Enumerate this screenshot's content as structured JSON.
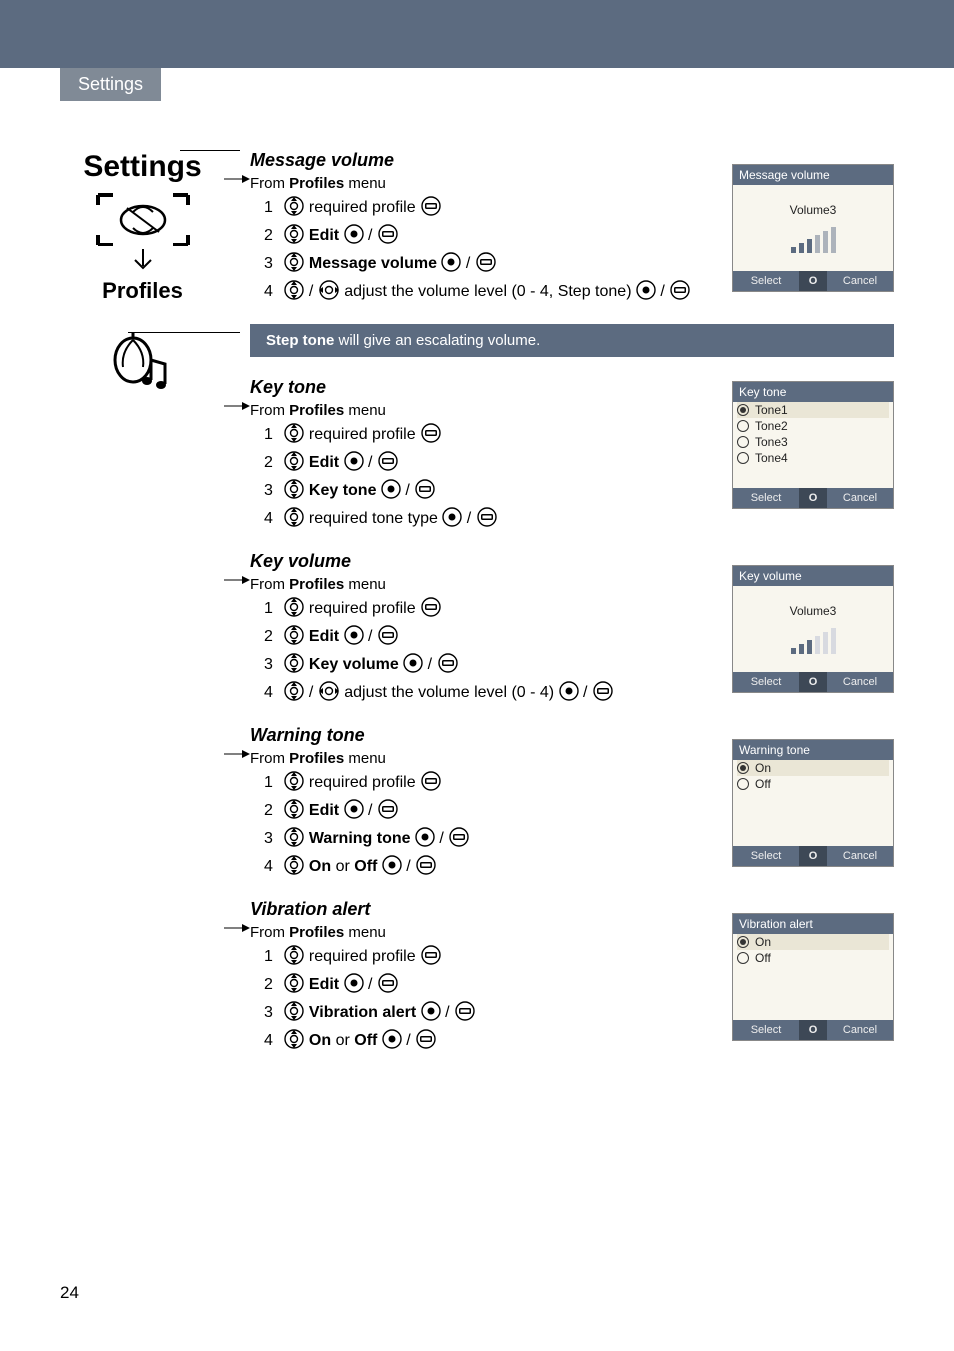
{
  "header": {
    "section": "Settings"
  },
  "sidebar": {
    "title": "Settings",
    "subtitle": "Profiles"
  },
  "sections": {
    "msg_volume": {
      "title": "Message volume",
      "from": "From",
      "from_bold": "Profiles",
      "from_tail": "menu",
      "steps": [
        {
          "n": "1",
          "text": "required profile"
        },
        {
          "n": "2",
          "bold": "Edit"
        },
        {
          "n": "3",
          "bold": "Message volume"
        },
        {
          "n": "4",
          "text": "adjust the volume level (0 - 4, Step tone)"
        }
      ],
      "screen": {
        "title": "Message volume",
        "body": "Volume3",
        "sk_l": "Select",
        "sk_c": "O",
        "sk_r": "Cancel"
      }
    },
    "note": {
      "bold": "Step tone",
      "text": " will give an escalating volume."
    },
    "key_tone": {
      "title": "Key tone",
      "from": "From",
      "from_bold": "Profiles",
      "from_tail": "menu",
      "steps": [
        {
          "n": "1",
          "text": "required profile"
        },
        {
          "n": "2",
          "bold": "Edit"
        },
        {
          "n": "3",
          "bold": "Key tone"
        },
        {
          "n": "4",
          "text": "required tone type"
        }
      ],
      "screen": {
        "title": "Key tone",
        "opts": [
          "Tone1",
          "Tone2",
          "Tone3",
          "Tone4"
        ],
        "sk_l": "Select",
        "sk_c": "O",
        "sk_r": "Cancel"
      }
    },
    "key_volume": {
      "title": "Key volume",
      "from": "From",
      "from_bold": "Profiles",
      "from_tail": "menu",
      "steps": [
        {
          "n": "1",
          "text": "required profile"
        },
        {
          "n": "2",
          "bold": "Edit"
        },
        {
          "n": "3",
          "bold": "Key volume"
        },
        {
          "n": "4",
          "text": "adjust the volume level (0 - 4)"
        }
      ],
      "screen": {
        "title": "Key volume",
        "body": "Volume3",
        "sk_l": "Select",
        "sk_c": "O",
        "sk_r": "Cancel"
      }
    },
    "warning_tone": {
      "title": "Warning tone",
      "from": "From",
      "from_bold": "Profiles",
      "from_tail": "menu",
      "steps": [
        {
          "n": "1",
          "text": "required profile"
        },
        {
          "n": "2",
          "bold": "Edit"
        },
        {
          "n": "3",
          "bold": "Warning tone"
        },
        {
          "n": "4",
          "bold_multi": "On",
          "mid": " or ",
          "bold_multi2": "Off"
        }
      ],
      "screen": {
        "title": "Warning tone",
        "opts": [
          "On",
          "Off"
        ],
        "sk_l": "Select",
        "sk_c": "O",
        "sk_r": "Cancel"
      }
    },
    "vibration": {
      "title": "Vibration alert",
      "from": "From",
      "from_bold": "Profiles",
      "from_tail": "menu",
      "steps": [
        {
          "n": "1",
          "text": "required profile"
        },
        {
          "n": "2",
          "bold": "Edit"
        },
        {
          "n": "3",
          "bold": "Vibration alert"
        },
        {
          "n": "4",
          "bold_multi": "On",
          "mid": " or ",
          "bold_multi2": "Off"
        }
      ],
      "screen": {
        "title": "Vibration alert",
        "opts": [
          "On",
          "Off"
        ],
        "sk_l": "Select",
        "sk_c": "O",
        "sk_r": "Cancel"
      }
    }
  },
  "page_number": "24"
}
